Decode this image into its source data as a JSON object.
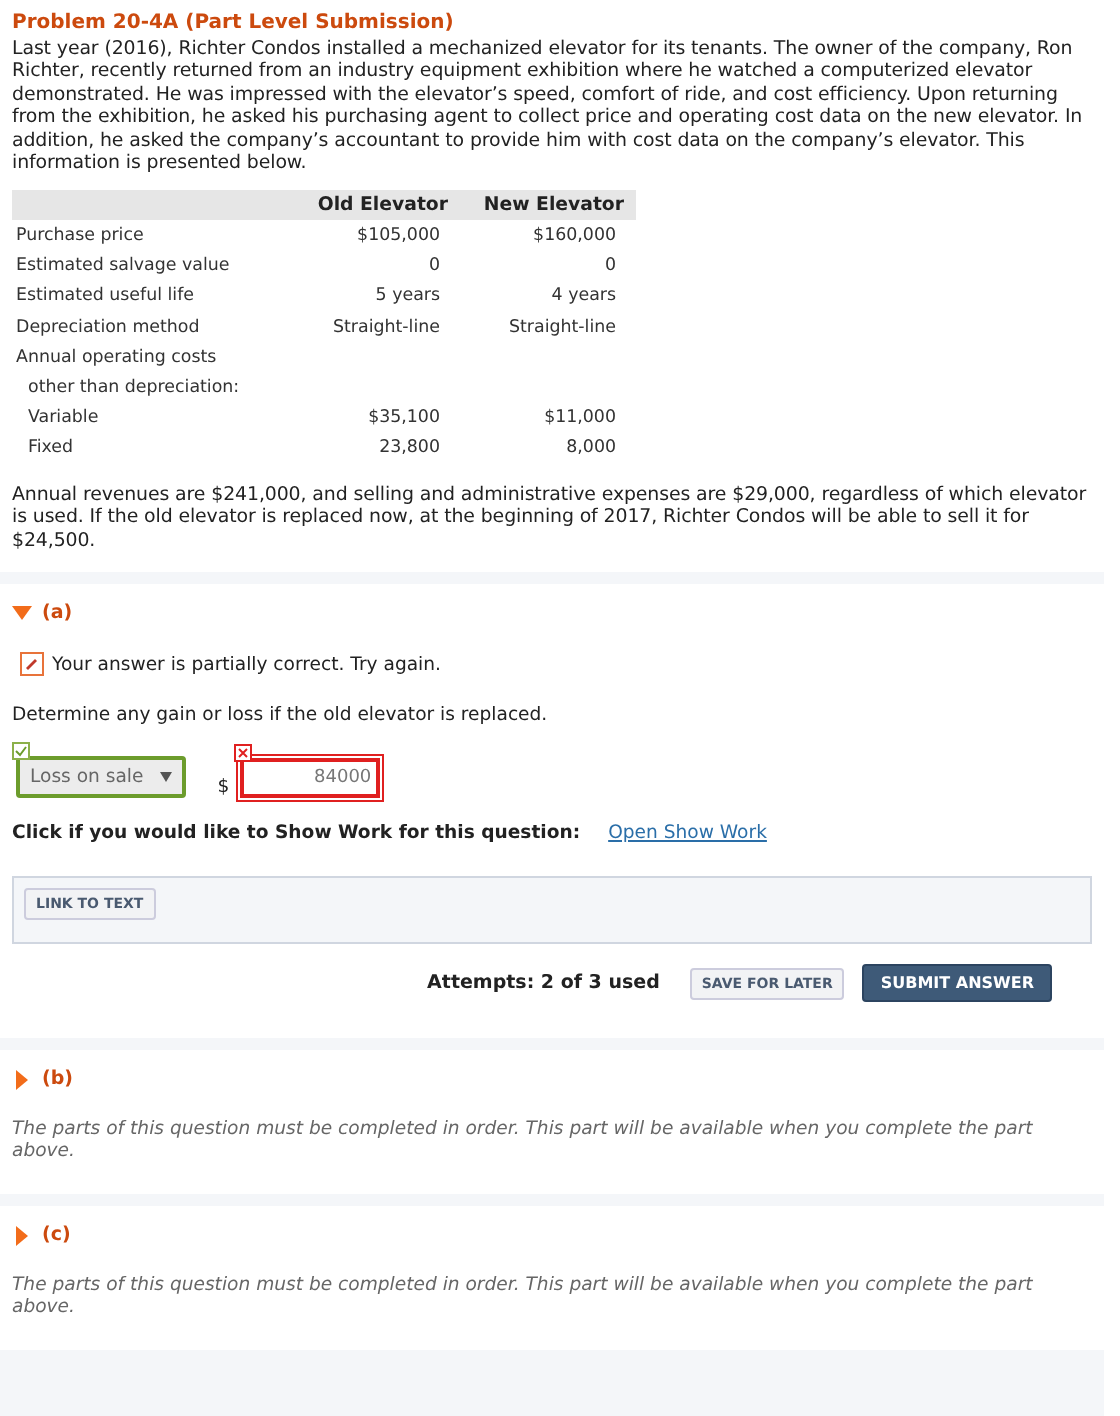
{
  "problem": {
    "title": "Problem 20-4A (Part Level Submission)",
    "text": "Last year (2016), Richter Condos installed a mechanized elevator for its tenants. The owner of the company, Ron Richter, recently returned from an industry equipment exhibition where he watched a computerized elevator demonstrated. He was impressed with the elevator’s speed, comfort of ride, and cost efficiency. Upon returning from the exhibition, he asked his purchasing agent to collect price and operating cost data on the new elevator. In addition, he asked the company’s accountant to provide him with cost data on the company’s elevator. This information is presented below."
  },
  "table": {
    "columns": [
      "Old Elevator",
      "New Elevator"
    ],
    "rows": [
      {
        "label": "Purchase price",
        "indent": false,
        "values": [
          "$105,000",
          "$160,000"
        ]
      },
      {
        "label": "Estimated salvage value",
        "indent": false,
        "values": [
          "0",
          "0"
        ]
      },
      {
        "label": "Estimated useful life",
        "indent": false,
        "values": [
          "5 years",
          "4 years"
        ]
      },
      {
        "label": "Depreciation method",
        "indent": false,
        "values": [
          "Straight-line",
          "Straight-line"
        ]
      },
      {
        "label": "Annual operating costs",
        "indent": false,
        "values": []
      },
      {
        "label": "other than depreciation:",
        "indent": true,
        "values": []
      },
      {
        "label": "Variable",
        "indent": true,
        "values": [
          "$35,100",
          "$11,000"
        ]
      },
      {
        "label": "Fixed",
        "indent": true,
        "values": [
          "23,800",
          "8,000"
        ]
      }
    ]
  },
  "after_text": "Annual revenues are $241,000, and selling and administrative expenses are $29,000, regardless of which elevator is used. If the old elevator is replaced now, at the beginning of 2017, Richter Condos will be able to sell it for $24,500.",
  "parts": [
    {
      "label": "(a)",
      "expanded": true,
      "feedback": "Your answer is partially correct.  Try again.",
      "question": "Determine any gain or loss if the old elevator is replaced.",
      "select": {
        "value": "Loss on sale",
        "correct": true
      },
      "currency": "$",
      "input": {
        "value": "84000",
        "correct": false
      },
      "show_work_label": "Click if you would like to Show Work for this question:",
      "show_work_link": "Open Show Work",
      "link_button": "LINK TO TEXT",
      "attempts": "Attempts: 2 of 3 used",
      "save_button": "SAVE FOR LATER",
      "submit_button": "SUBMIT ANSWER"
    },
    {
      "label": "(b)",
      "expanded": false,
      "locked_text": "The parts of this question must be completed in order. This part will be available when you complete the part above."
    },
    {
      "label": "(c)",
      "expanded": false,
      "locked_text": "The parts of this question must be completed in order. This part will be available when you complete the part above."
    }
  ]
}
